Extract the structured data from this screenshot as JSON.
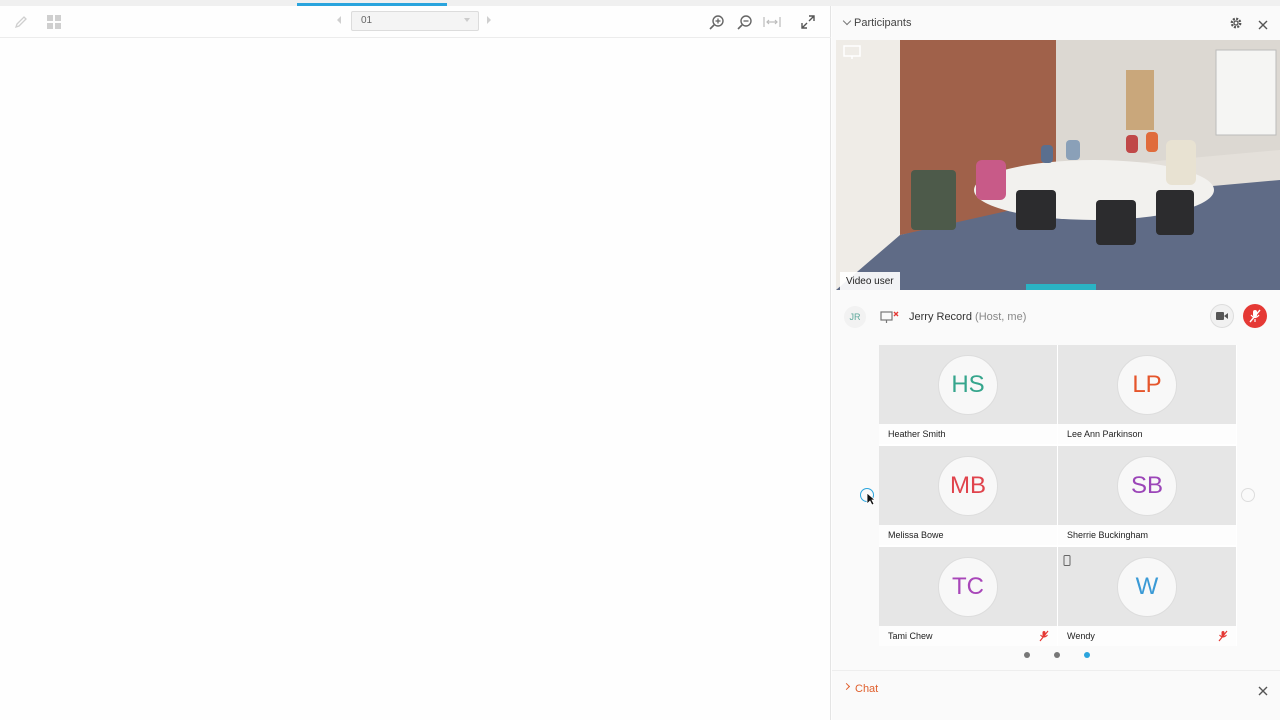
{
  "toolbar": {
    "page_value": "01",
    "icons": [
      "pencil-icon",
      "thumbnails-icon",
      "prev-page-icon",
      "next-page-icon",
      "zoom-in-icon",
      "zoom-out-icon",
      "fit-width-icon",
      "fullscreen-icon"
    ]
  },
  "participants": {
    "title": "Participants",
    "video_label": "Video user",
    "host": {
      "initials": "JR",
      "name": "Jerry Record",
      "role": "(Host, me)"
    },
    "tiles": [
      {
        "initials": "HS",
        "name": "Heather Smith",
        "color": "#35a58c",
        "muted": false
      },
      {
        "initials": "LP",
        "name": "Lee Ann Parkinson",
        "color": "#e5552b",
        "muted": false
      },
      {
        "initials": "MB",
        "name": "Melissa Bowe",
        "color": "#e0434c",
        "muted": false
      },
      {
        "initials": "SB",
        "name": "Sherrie Buckingham",
        "color": "#9b45b8",
        "muted": false
      },
      {
        "initials": "TC",
        "name": "Tami Chew",
        "color": "#a846b9",
        "muted": true
      },
      {
        "initials": "W",
        "name": "Wendy",
        "color": "#3a9ad6",
        "muted": true
      }
    ],
    "pages": {
      "count": 3,
      "active": 3
    }
  },
  "chat": {
    "label": "Chat"
  },
  "colors": {
    "accent": "#2aa4dd",
    "danger": "#e53935",
    "chat": "#e0602e"
  }
}
